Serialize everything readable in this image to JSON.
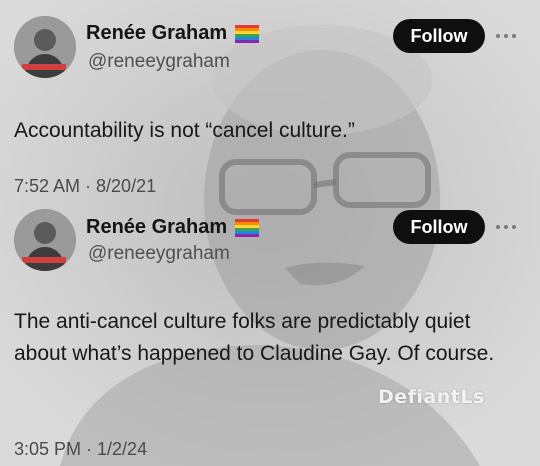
{
  "tweets": [
    {
      "display_name": "Renée Graham",
      "badge": "🏳️‍🌈",
      "handle": "@reneeygraham",
      "follow_label": "Follow",
      "text": "Accountability is not “cancel culture.”",
      "timestamp": "7:52 AM · 8/20/21"
    },
    {
      "display_name": "Renée Graham",
      "badge": "🏳️‍🌈",
      "handle": "@reneeygraham",
      "follow_label": "Follow",
      "text": "The anti-cancel culture folks are predictably quiet about what’s happened to Claudine Gay. Of course.",
      "timestamp": "3:05 PM · 1/2/24"
    }
  ],
  "watermark": "DefiantLs",
  "icons": {
    "more": "more-options-icon",
    "flag": "rainbow-flag-icon"
  },
  "colors": {
    "background": "#d9d9d9",
    "follow_button": "#0f0f0f",
    "text": "#141414",
    "muted": "#505050"
  }
}
